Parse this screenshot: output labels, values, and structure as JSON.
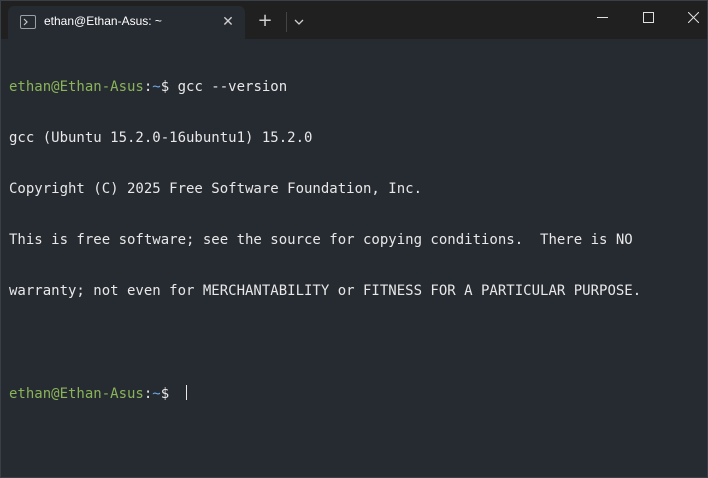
{
  "tab": {
    "title": "ethan@Ethan-Asus: ~",
    "close_glyph": "✕",
    "new_tab_glyph": "+"
  },
  "terminal": {
    "prompt_user": "ethan@Ethan-Asus",
    "prompt_sep": ":",
    "prompt_path": "~",
    "prompt_symbol": "$ ",
    "command": "gcc --version",
    "output": [
      "gcc (Ubuntu 15.2.0-16ubuntu1) 15.2.0",
      "Copyright (C) 2025 Free Software Foundation, Inc.",
      "This is free software; see the source for copying conditions.  There is NO",
      "warranty; not even for MERCHANTABILITY or FITNESS FOR A PARTICULAR PURPOSE."
    ]
  },
  "colors": {
    "background": "#262a31",
    "titlebar": "#202020",
    "prompt_user": "#8ab45a",
    "prompt_path": "#6fa8e8",
    "text": "#e8e8e8"
  },
  "icons": {
    "tab_icon": "terminal-prompt-icon",
    "close": "close-icon",
    "dropdown": "chevron-down-icon",
    "minimize": "minimize-icon",
    "maximize": "maximize-icon",
    "window_close": "window-close-icon"
  }
}
